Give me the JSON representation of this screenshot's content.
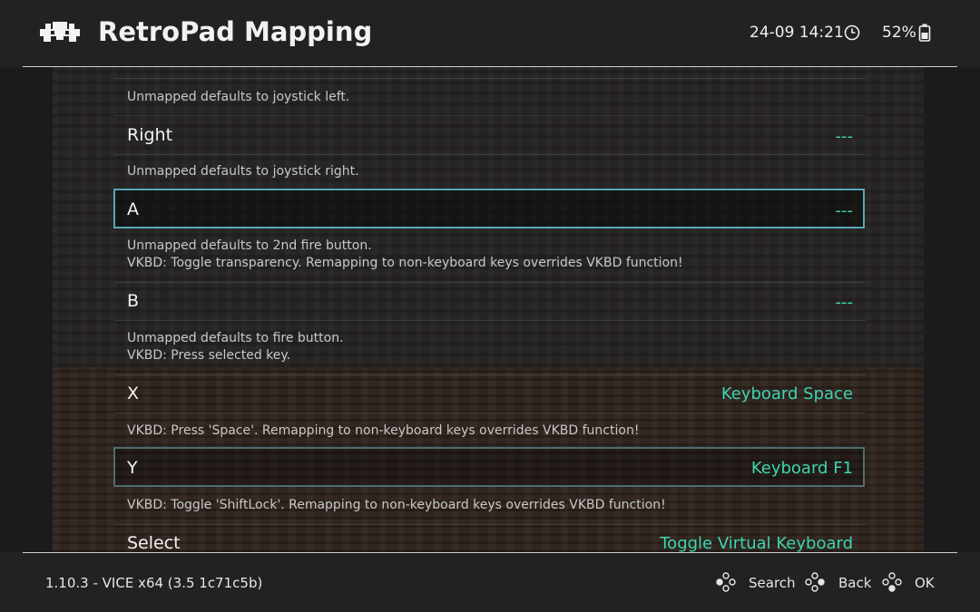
{
  "header": {
    "title": "RetroPad Mapping",
    "clock": "24-09 14:21",
    "battery": "52%"
  },
  "list": {
    "top_desc": "Unmapped defaults to joystick left.",
    "items": [
      {
        "label": "Right",
        "value": "---",
        "desc": [
          "Unmapped defaults to joystick right."
        ]
      },
      {
        "label": "A",
        "value": "---",
        "desc": [
          "Unmapped defaults to 2nd fire button.",
          "VKBD: Toggle transparency. Remapping to non-keyboard keys overrides VKBD function!"
        ]
      },
      {
        "label": "B",
        "value": "---",
        "desc": [
          "Unmapped defaults to fire button.",
          "VKBD: Press selected key."
        ]
      },
      {
        "label": "X",
        "value": "Keyboard Space",
        "desc": [
          "VKBD: Press 'Space'. Remapping to non-keyboard keys overrides VKBD function!"
        ]
      },
      {
        "label": "Y",
        "value": "Keyboard F1",
        "desc": [
          "VKBD: Toggle 'ShiftLock'. Remapping to non-keyboard keys overrides VKBD function!"
        ]
      },
      {
        "label": "Select",
        "value": "Toggle Virtual Keyboard",
        "desc": []
      }
    ]
  },
  "footer": {
    "version": "1.10.3 - VICE x64 (3.5 1c71c5b)",
    "hints": {
      "search": "Search",
      "back": "Back",
      "ok": "OK"
    }
  },
  "colors": {
    "accent": "#3fd4b0",
    "selection_border": "#58a8b4"
  }
}
